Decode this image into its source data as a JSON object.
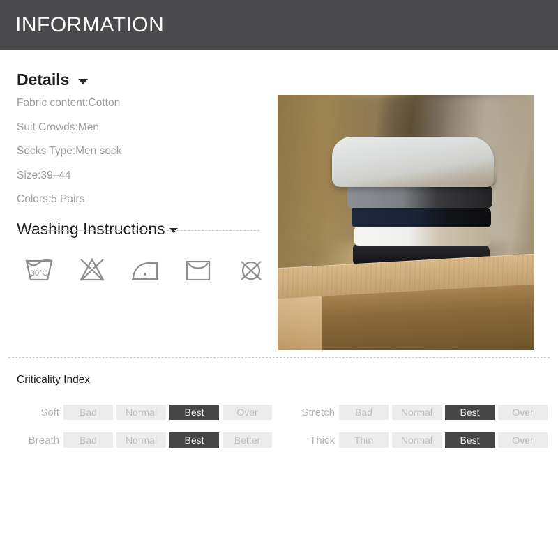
{
  "header": {
    "title": "INFORMATION"
  },
  "details": {
    "title": "Details",
    "caret_icon": "chevron-down-icon",
    "items": [
      "Fabric content:Cotton",
      "Suit Crowds:Men",
      "Socks Type:Men sock",
      "Size:39–44",
      "Colors:5 Pairs"
    ]
  },
  "washing": {
    "title": "Washing Instructions",
    "caret_icon": "chevron-down-icon",
    "icons": [
      {
        "name": "wash-30c-icon",
        "label": "30°C"
      },
      {
        "name": "do-not-bleach-icon",
        "label": ""
      },
      {
        "name": "iron-low-icon",
        "label": ""
      },
      {
        "name": "drip-dry-icon",
        "label": ""
      },
      {
        "name": "do-not-dry-clean-icon",
        "label": ""
      }
    ]
  },
  "photo": {
    "alt": "stack of folded socks on wooden block"
  },
  "criticality": {
    "title": "Criticality Index",
    "active_color": "#454545",
    "chip_color": "#ececec",
    "rows": [
      {
        "left": {
          "label": "Soft",
          "options": [
            "Bad",
            "Normal",
            "Best",
            "Over"
          ],
          "selected": 2
        },
        "right": {
          "label": "Stretch",
          "options": [
            "Bad",
            "Normal",
            "Best",
            "Over"
          ],
          "selected": 2
        }
      },
      {
        "left": {
          "label": "Breath",
          "options": [
            "Bad",
            "Normal",
            "Best",
            "Better"
          ],
          "selected": 2
        },
        "right": {
          "label": "Thick",
          "options": [
            "Thin",
            "Normal",
            "Best",
            "Over"
          ],
          "selected": 2
        }
      }
    ]
  }
}
